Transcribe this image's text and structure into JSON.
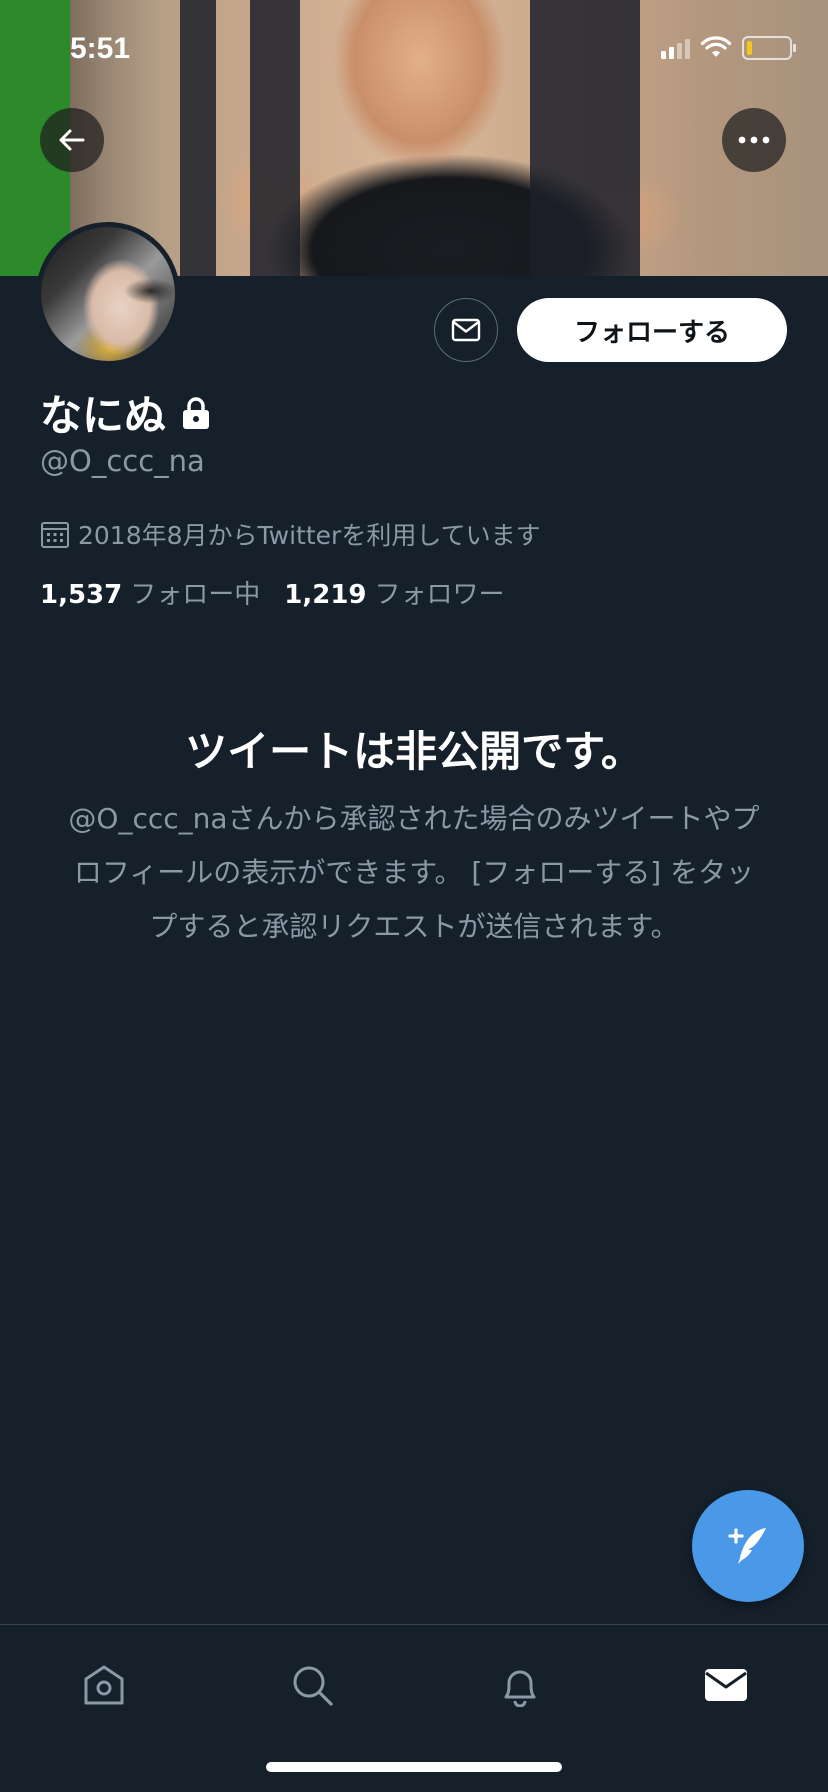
{
  "status_bar": {
    "time": "5:51"
  },
  "profile": {
    "display_name": "なにぬ",
    "handle": "@O_ccc_na",
    "joined": "2018年8月からTwitterを利用しています",
    "following_count": "1,537",
    "following_label": "フォロー中",
    "followers_count": "1,219",
    "followers_label": "フォロワー"
  },
  "actions": {
    "follow_label": "フォローする"
  },
  "private_notice": {
    "title": "ツイートは非公開です。",
    "body": "@O_ccc_naさんから承認された場合のみツイートやプロフィールの表示ができます。 [フォローする] をタップすると承認リクエストが送信されます。"
  },
  "tabbar": {
    "items": [
      "home-icon",
      "search-icon",
      "notifications-icon",
      "messages-icon"
    ]
  },
  "colors": {
    "background": "#15202b",
    "accent": "#4a99e9",
    "secondary_text": "#8b98a5"
  }
}
